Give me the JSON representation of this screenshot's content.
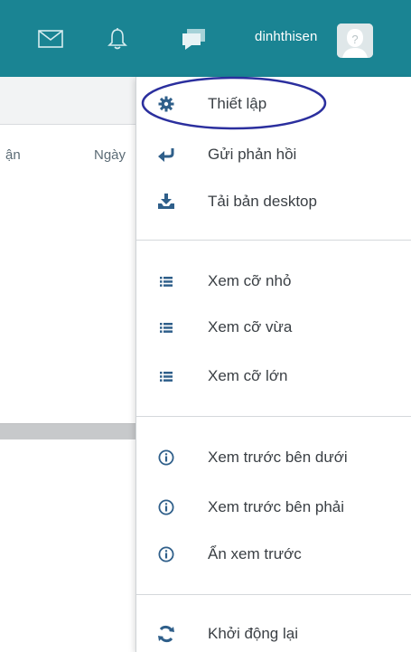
{
  "topbar": {
    "username": "dinhthisen",
    "icons": [
      "mail-icon",
      "bell-icon",
      "chat-icon"
    ],
    "color": "#1a8493"
  },
  "background": {
    "col_left": "ận",
    "col_date": "Ngày"
  },
  "menu": {
    "items": [
      {
        "label": "Thiết lập",
        "icon": "gear-icon"
      },
      {
        "label": "Gửi phản hồi",
        "icon": "reply-arrow-icon"
      },
      {
        "label": "Tải bản desktop",
        "icon": "download-tray-icon"
      },
      {
        "label": "Xem cỡ nhỏ",
        "icon": "list-icon"
      },
      {
        "label": "Xem cỡ vừa",
        "icon": "list-icon"
      },
      {
        "label": "Xem cỡ lớn",
        "icon": "list-icon"
      },
      {
        "label": "Xem trước bên dưới",
        "icon": "info-icon"
      },
      {
        "label": "Xem trước bên phải",
        "icon": "info-icon"
      },
      {
        "label": "Ẩn xem trước",
        "icon": "info-icon"
      },
      {
        "label": "Khởi động lại",
        "icon": "refresh-icon"
      }
    ],
    "icon_color": "#2f5f8a",
    "highlight_color": "#2b2f9e"
  }
}
